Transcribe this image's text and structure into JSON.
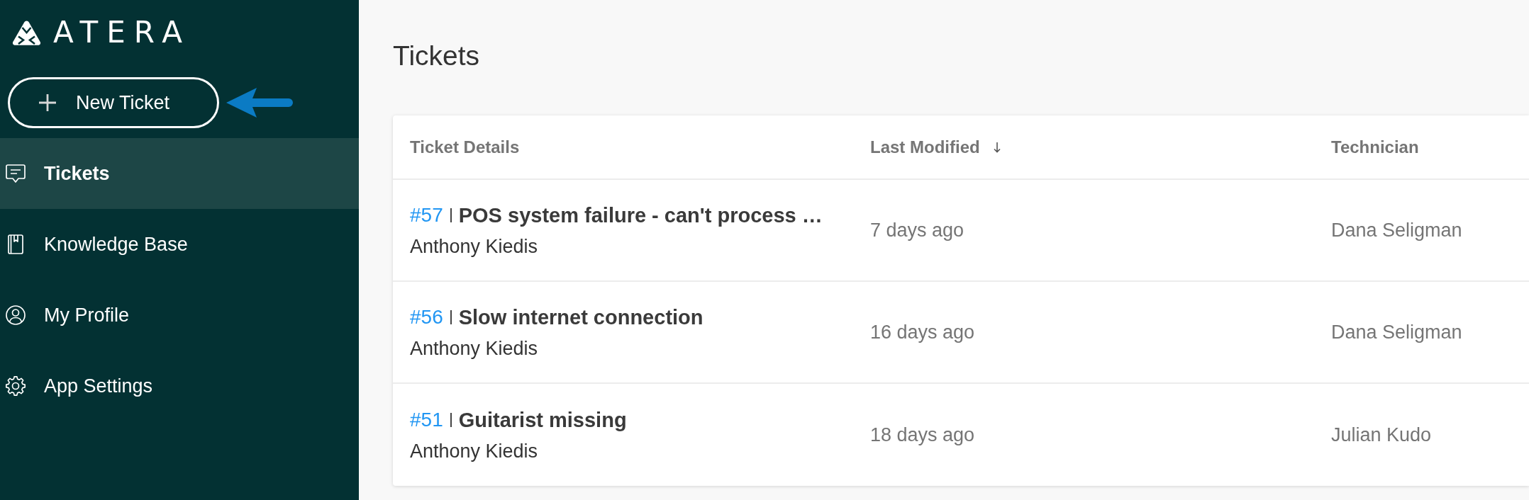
{
  "sidebar": {
    "logo": {
      "text": "ATERA"
    },
    "new_ticket_button": {
      "label": "New Ticket"
    },
    "items": [
      {
        "label": "Tickets",
        "selected": true
      },
      {
        "label": "Knowledge Base",
        "selected": false
      },
      {
        "label": "My Profile",
        "selected": false
      },
      {
        "label": "App Settings",
        "selected": false
      }
    ]
  },
  "main": {
    "title": "Tickets",
    "table": {
      "columns": [
        {
          "label": "Ticket Details",
          "sorted": false
        },
        {
          "label": "Last Modified",
          "sorted": true
        },
        {
          "label": "Technician",
          "sorted": false
        }
      ],
      "rows": [
        {
          "number": "#57",
          "title": "POS system failure - can't process …",
          "requester": "Anthony Kiedis",
          "last_modified": "7 days ago",
          "technician": "Dana Seligman"
        },
        {
          "number": "#56",
          "title": "Slow internet connection",
          "requester": "Anthony Kiedis",
          "last_modified": "16 days ago",
          "technician": "Dana Seligman"
        },
        {
          "number": "#51",
          "title": "Guitarist missing",
          "requester": "Anthony Kiedis",
          "last_modified": "18 days ago",
          "technician": "Julian Kudo"
        }
      ]
    }
  }
}
